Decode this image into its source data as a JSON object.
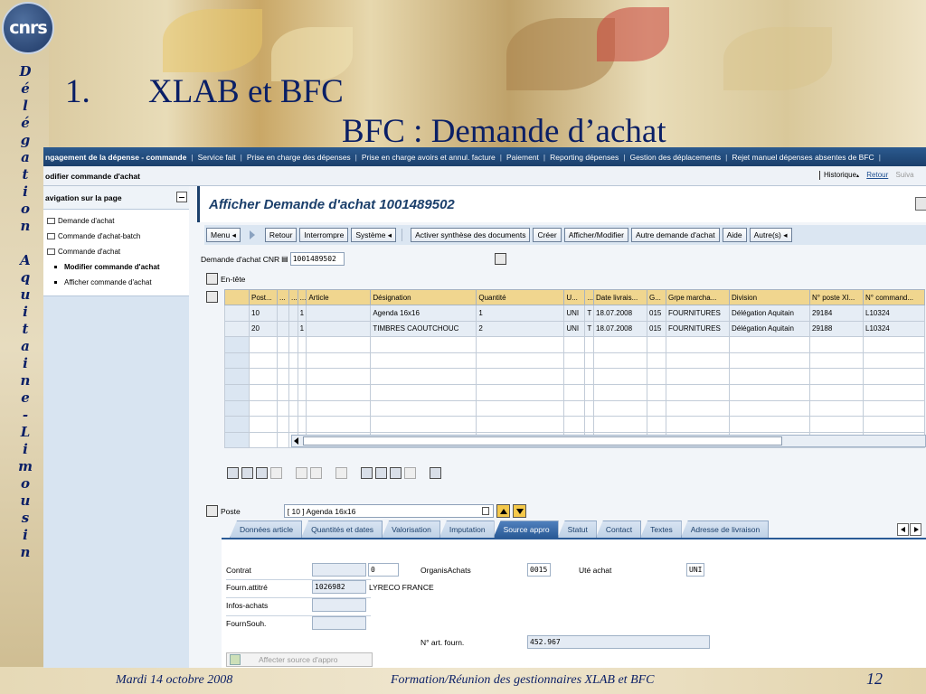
{
  "slide": {
    "logo_text": "cnrs",
    "vertical_text": [
      "D",
      "é",
      "l",
      "é",
      "g",
      "a",
      "t",
      "i",
      "o",
      "n",
      " ",
      "A",
      "q",
      "u",
      "i",
      "t",
      "a",
      "i",
      "n",
      "e",
      "-",
      "L",
      "i",
      "m",
      "o",
      "u",
      "s",
      "i",
      "n"
    ],
    "heading_number": "1.",
    "heading_text": "XLAB et BFC",
    "subheading": "BFC : Demande d’achat",
    "footer_date": "Mardi 14 octobre 2008",
    "footer_center": "Formation/Réunion des gestionnaires XLAB et BFC",
    "page_number": "12"
  },
  "topnav": {
    "items": [
      "ngagement de la dépense - commande",
      "Service fait",
      "Prise en charge des dépenses",
      "Prise en charge avoirs et annul. facture",
      "Paiement",
      "Reporting dépenses",
      "Gestion des déplacements",
      "Rejet manuel dépenses absentes de BFC"
    ]
  },
  "subbar": {
    "title": "odifier commande d'achat",
    "history": "Historique",
    "back": "Retour",
    "next": "Suiva"
  },
  "leftnav": {
    "header": "avigation sur la page",
    "folders": [
      "Demande d'achat",
      "Commande d'achat-batch",
      "Commande d'achat"
    ],
    "children": [
      "Modifier commande d'achat",
      "Afficher commande d'achat"
    ]
  },
  "main": {
    "title": "Afficher Demande d'achat 1001489502",
    "toolbar": {
      "menu": "Menu",
      "retour": "Retour",
      "interrompre": "Interrompre",
      "systeme": "Système",
      "activer": "Activer synthèse des documents",
      "creer": "Créer",
      "afficher": "Afficher/Modifier",
      "autre": "Autre demande d'achat",
      "aide": "Aide",
      "autres": "Autre(s)"
    },
    "demande_label": "Demande d'achat CNR",
    "demande_value": "1001489502",
    "entete": "En-tête"
  },
  "grid": {
    "headers": [
      "Post...",
      "...",
      "...",
      "...",
      "Article",
      "Désignation",
      "Quantité",
      "U...",
      "...",
      "Date livrais...",
      "G...",
      "Grpe marcha...",
      "Division",
      "N° poste XI...",
      "N° command..."
    ],
    "rows": [
      [
        "10",
        "",
        "",
        "1",
        "",
        "Agenda 16x16",
        "1",
        "UNI",
        "T",
        "18.07.2008",
        "015",
        "FOURNITURES",
        "Délégation Aquitain",
        "29184",
        "L10324"
      ],
      [
        "20",
        "",
        "",
        "1",
        "",
        "TIMBRES CAOUTCHOUC",
        "2",
        "UNI",
        "T",
        "18.07.2008",
        "015",
        "FOURNITURES",
        "Délégation Aquitain",
        "29188",
        "L10324"
      ]
    ]
  },
  "poste": {
    "label": "Poste",
    "value": "[ 10 ] Agenda 16x16"
  },
  "tabs": [
    "Données article",
    "Quantités et dates",
    "Valorisation",
    "Imputation",
    "Source appro",
    "Statut",
    "Contact",
    "Textes",
    "Adresse de livraison"
  ],
  "active_tab": "Source appro",
  "source_appro": {
    "contrat_label": "Contrat",
    "contrat_pos": "0",
    "organis_label": "OrganisAchats",
    "organis_value": "0015",
    "ute_label": "Uté achat",
    "ute_value": "UNI",
    "fourn_label": "Fourn.attitré",
    "fourn_value": "1026982",
    "fourn_name": "LYRECO FRANCE",
    "infos_label": "Infos-achats",
    "fournsouh_label": "FournSouh.",
    "nart_label": "N° art. fourn.",
    "nart_value": "452.967",
    "assign_button": "Affecter source d'appro"
  }
}
